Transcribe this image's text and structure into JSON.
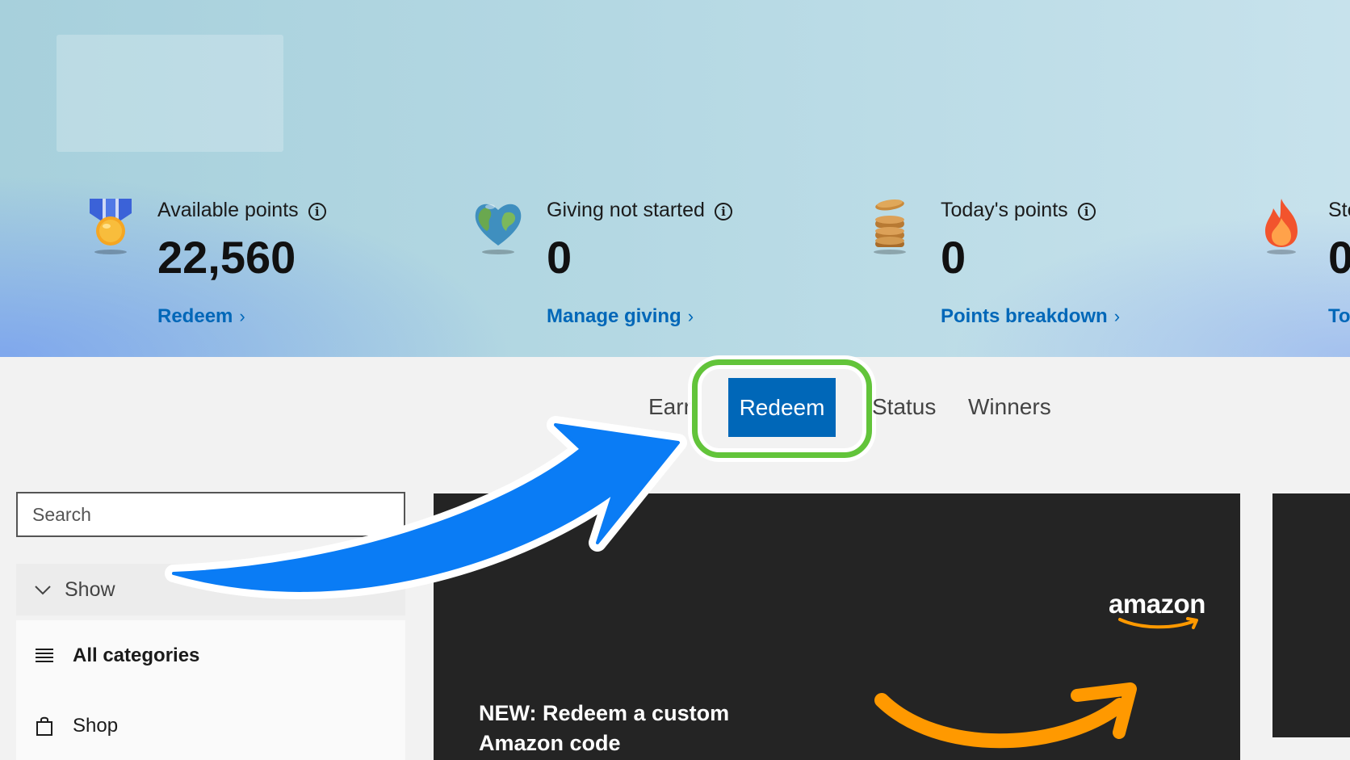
{
  "stats": [
    {
      "label": "Available points",
      "value": "22,560",
      "link": "Redeem",
      "icon": "medal-icon"
    },
    {
      "label": "Giving not started",
      "value": "0",
      "link": "Manage giving",
      "icon": "globe-heart-icon"
    },
    {
      "label": "Today's points",
      "value": "0",
      "link": "Points breakdown",
      "icon": "coin-stack-icon"
    },
    {
      "label": "Ste",
      "value": "0",
      "link": "To",
      "icon": "flame-icon"
    }
  ],
  "tabs": {
    "earn": "Earr",
    "redeem": "Redeem",
    "status": "Status",
    "winners": "Winners"
  },
  "sidebar": {
    "search_placeholder": "Search",
    "show_label": "Show",
    "categories": [
      {
        "label": "All categories",
        "icon": "list-icon"
      },
      {
        "label": "Shop",
        "icon": "shopping-bag-icon"
      }
    ]
  },
  "card": {
    "brand": "amazon",
    "title": "NEW: Redeem a custom Amazon code"
  },
  "colors": {
    "link": "#0067b8",
    "active_tab": "#0067b8",
    "highlight_ring": "#62c43a",
    "annotation_arrow": "#0a7cf5",
    "amazon_orange": "#ff9900",
    "card_bg": "#242424"
  }
}
